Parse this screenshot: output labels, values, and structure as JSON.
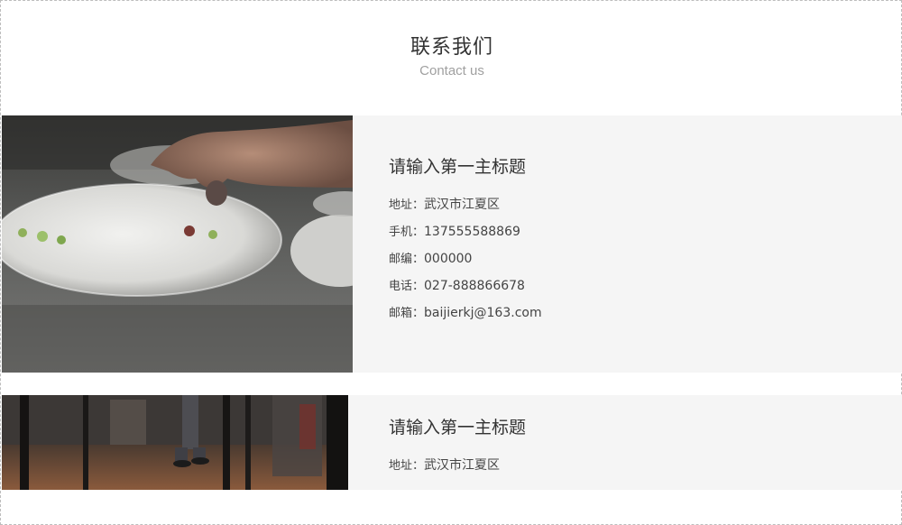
{
  "header": {
    "title": "联系我们",
    "subtitle": "Contact us"
  },
  "cards": [
    {
      "photo": "dining-plate-photo",
      "title": "请输入第一主标题",
      "lines": [
        {
          "label": "地址：",
          "value": "武汉市江夏区"
        },
        {
          "label": "手机：",
          "value": "137555588869"
        },
        {
          "label": "邮编：",
          "value": "000000"
        },
        {
          "label": "电话：",
          "value": "027-888866678"
        },
        {
          "label": "邮箱：",
          "value": "baijierkj@163.com"
        }
      ]
    },
    {
      "photo": "hallway-photo",
      "title": "请输入第一主标题",
      "lines": [
        {
          "label": "地址：",
          "value": "武汉市江夏区"
        }
      ]
    }
  ],
  "colors": {
    "card_bg": "#f5f5f5",
    "title": "#333333",
    "subtitle": "#a0a0a0",
    "border": "#bdbdbd"
  }
}
